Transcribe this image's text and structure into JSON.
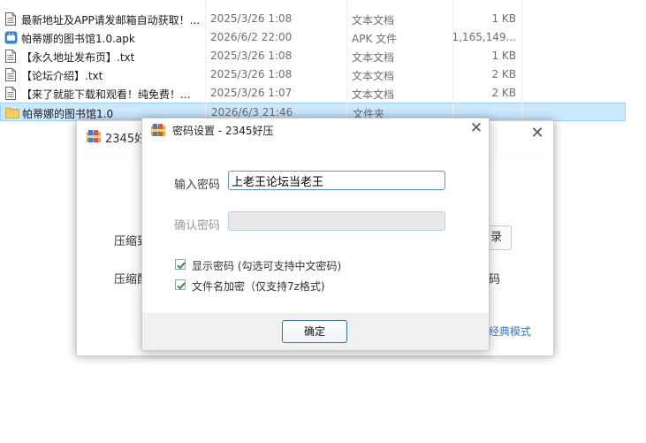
{
  "files": [
    {
      "name": "最新地址及APP请发邮箱自动获取！...",
      "date": "2025/3/26 1:08",
      "type": "文本文档",
      "size": "1 KB",
      "icon": "text-file-icon"
    },
    {
      "name": "帕蒂娜的图书馆1.0.apk",
      "date": "2026/6/2 22:00",
      "type": "APK 文件",
      "size": "1,165,149...",
      "icon": "apk-file-icon"
    },
    {
      "name": "【永久地址发布页】.txt",
      "date": "2025/3/26 1:08",
      "type": "文本文档",
      "size": "1 KB",
      "icon": "text-file-icon"
    },
    {
      "name": "【论坛介绍】.txt",
      "date": "2025/3/26 1:08",
      "type": "文本文档",
      "size": "2 KB",
      "icon": "text-file-icon"
    },
    {
      "name": "【来了就能下载和观看！纯免费！...",
      "date": "2025/3/26 1:07",
      "type": "文本文档",
      "size": "2 KB",
      "icon": "text-file-icon"
    },
    {
      "name": "帕蒂娜的图书馆1.0",
      "date": "2026/6/3 21:46",
      "type": "文件夹",
      "size": "",
      "icon": "folder-icon"
    }
  ],
  "bg_window": {
    "title": "2345好",
    "label1": "压缩到",
    "label2": "压缩配",
    "button_fragment": "录",
    "side_fragment": "码",
    "link_fragment": "经典模式"
  },
  "dialog": {
    "title": "密码设置 - 2345好压",
    "password_label": "输入密码",
    "password_value": "上老王论坛当老王",
    "confirm_label": "确认密码",
    "confirm_value": "",
    "show_password_label": "显示密码 (勾选可支持中文密码)",
    "show_password_checked": true,
    "encrypt_names_label": "文件名加密（仅支持7z格式)",
    "encrypt_names_checked": true,
    "ok_label": "确定"
  },
  "colors": {
    "selection_bg": "#cce8ff",
    "input_border": "#5b94d6",
    "check_green": "#2e8b3a",
    "link_blue": "#2f7dd6"
  }
}
